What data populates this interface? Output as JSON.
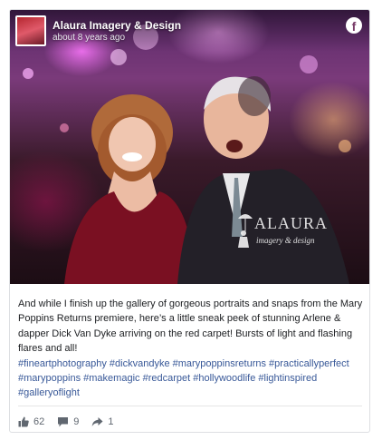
{
  "post": {
    "page_name": "Alaura Imagery & Design",
    "timestamp": "about 8 years ago",
    "body": "And while I finish up the gallery of gorgeous portraits and snaps from the Mary Poppins Returns premiere, here’s a little sneak peek of stunning Arlene & dapper Dick Van Dyke arriving on the red carpet! Bursts of light and flashing flares and all!",
    "hashtags": [
      "#fineartphotography",
      "#dickvandyke",
      "#marypoppinsreturns",
      "#practicallyperfect",
      "#marypoppins",
      "#makemagic",
      "#redcarpet",
      "#hollywoodlife",
      "#lightinspired",
      "#galleryoflight"
    ],
    "watermark": {
      "title": "ALAURA",
      "subtitle": "imagery & design"
    }
  },
  "footer": {
    "likes": "62",
    "comments": "9",
    "shares": "1"
  },
  "icons": {
    "brand": "facebook-icon",
    "like": "thumbs-up-icon",
    "comment": "comment-bubble-icon",
    "share": "share-arrow-icon"
  },
  "colors": {
    "link": "#385898",
    "text": "#1c1e21",
    "muted": "#606770"
  }
}
